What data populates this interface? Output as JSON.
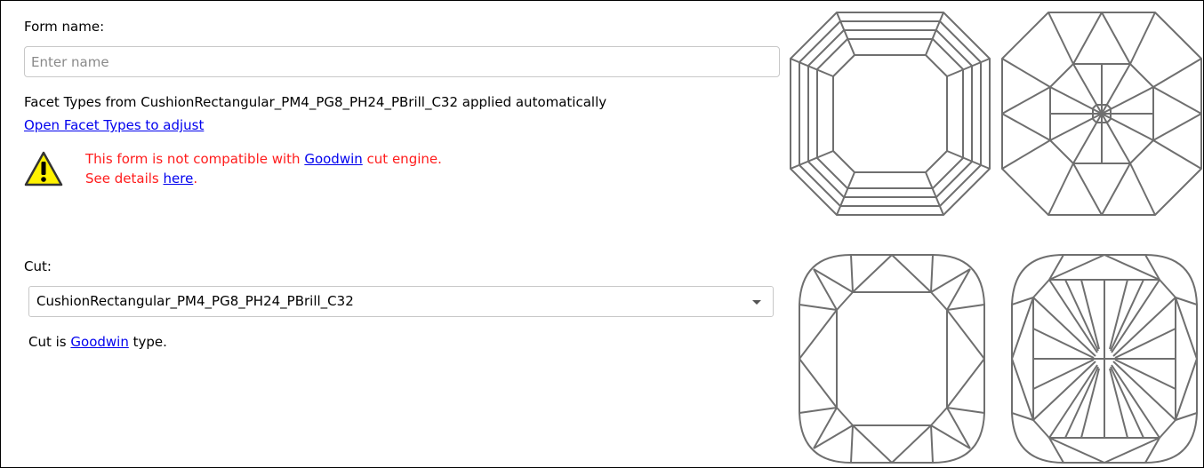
{
  "form": {
    "name_label": "Form name:",
    "name_value": "",
    "name_placeholder": "Enter name",
    "facet_info": "Facet Types from CushionRectangular_PM4_PG8_PH24_PBrill_C32 applied automatically",
    "facet_link": "Open Facet Types to adjust"
  },
  "warning": {
    "icon": "warning-triangle-icon",
    "line1_prefix": "This form is not compatible with ",
    "line1_link": "Goodwin",
    "line1_suffix": " cut engine.",
    "line2_prefix": "See details ",
    "line2_link": "here",
    "line2_suffix": ".",
    "color": "#ff1c1c"
  },
  "cut": {
    "label": "Cut:",
    "selected": "CushionRectangular_PM4_PG8_PH24_PBrill_C32",
    "info_prefix": "Cut is ",
    "info_link": "Goodwin",
    "info_suffix": " type."
  },
  "previews": [
    {
      "name": "octagon-crown-view-icon"
    },
    {
      "name": "octagon-pavilion-view-icon"
    },
    {
      "name": "cushion-crown-view-icon"
    },
    {
      "name": "cushion-pavilion-view-icon"
    }
  ]
}
